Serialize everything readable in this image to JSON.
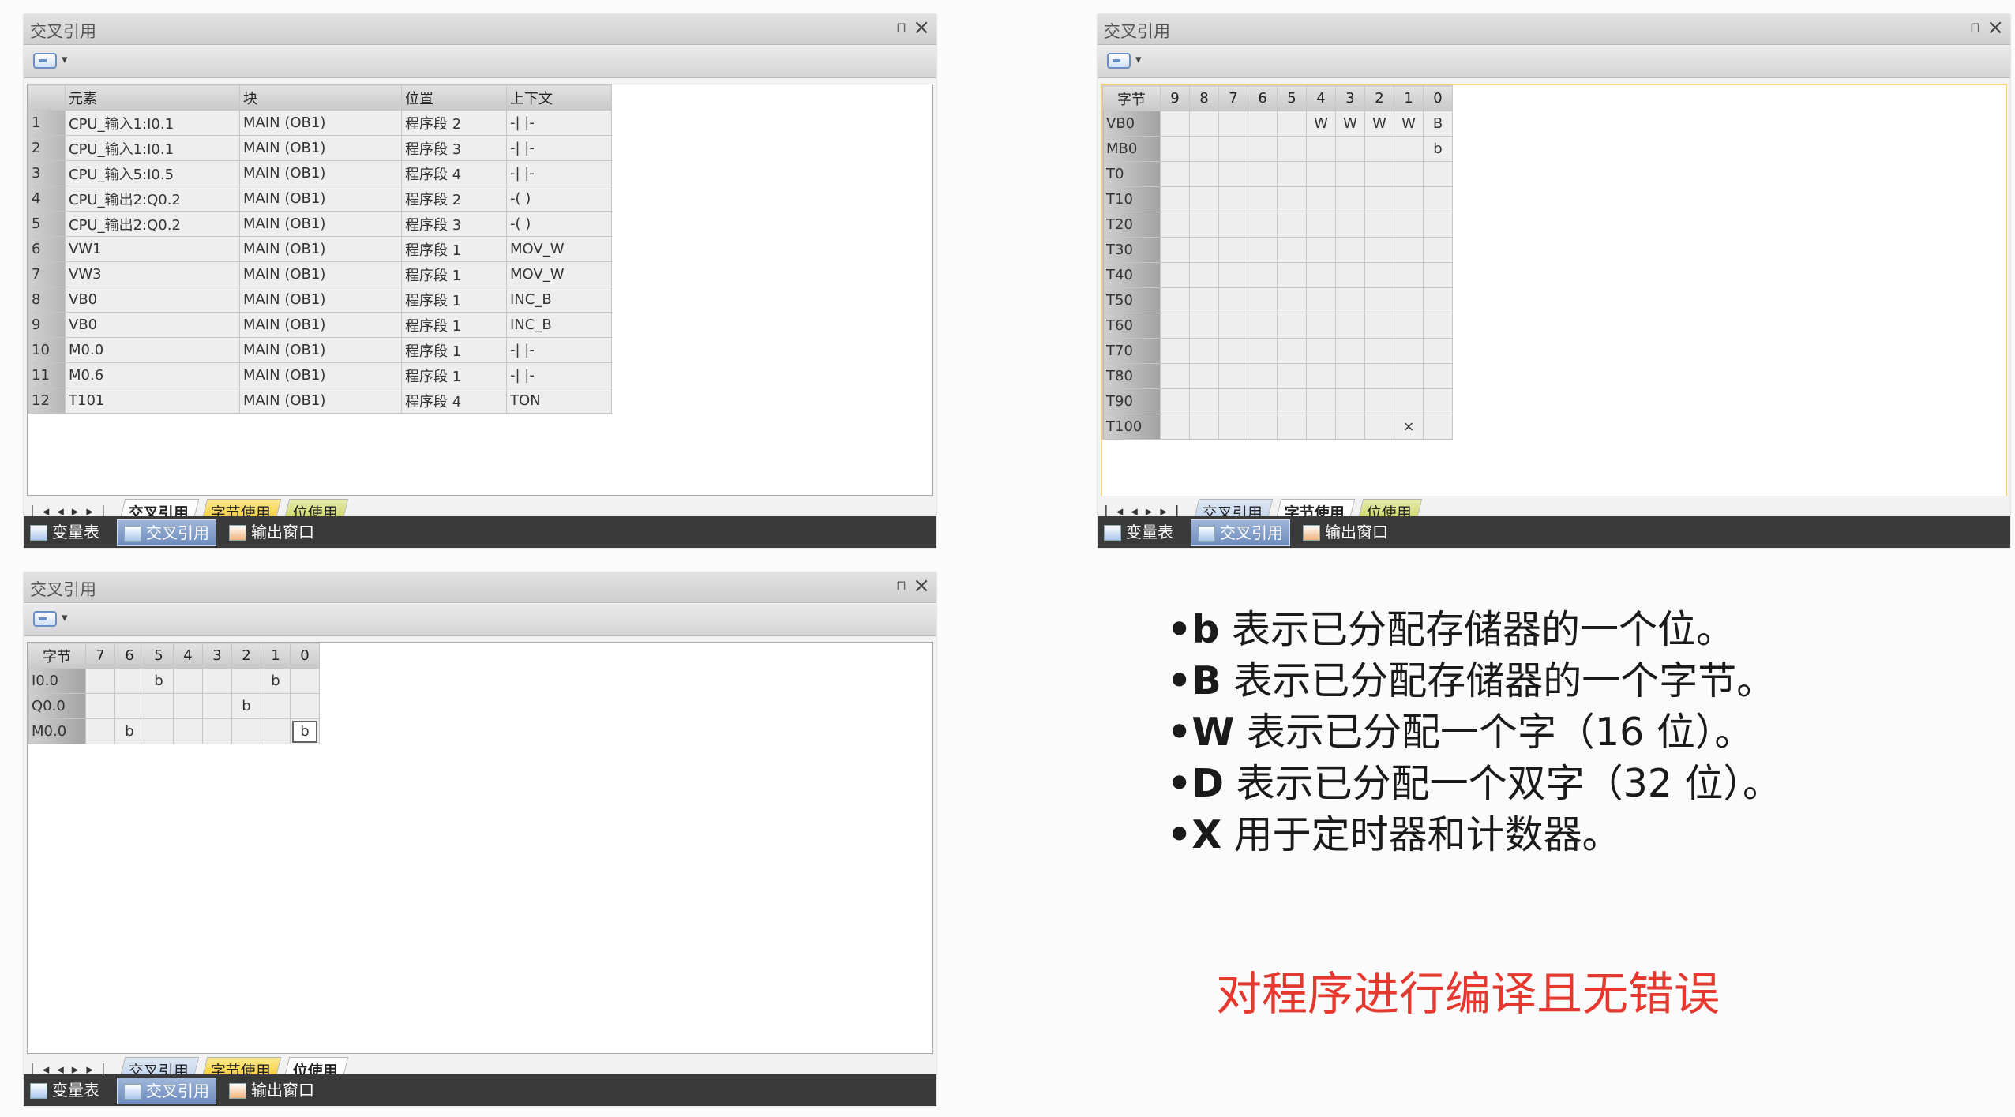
{
  "common": {
    "panel_title": "交叉引用",
    "tabs": [
      "交叉引用",
      "字节使用",
      "位使用"
    ],
    "status": [
      "变量表",
      "交叉引用",
      "输出窗口"
    ]
  },
  "cross_ref": {
    "headers": [
      "",
      "元素",
      "块",
      "位置",
      "上下文"
    ],
    "rows": [
      [
        "1",
        "CPU_输入1:I0.1",
        "MAIN (OB1)",
        "程序段 2",
        "-| |-"
      ],
      [
        "2",
        "CPU_输入1:I0.1",
        "MAIN (OB1)",
        "程序段 3",
        "-| |-"
      ],
      [
        "3",
        "CPU_输入5:I0.5",
        "MAIN (OB1)",
        "程序段 4",
        "-| |-"
      ],
      [
        "4",
        "CPU_输出2:Q0.2",
        "MAIN (OB1)",
        "程序段 2",
        "-( )"
      ],
      [
        "5",
        "CPU_输出2:Q0.2",
        "MAIN (OB1)",
        "程序段 3",
        "-( )"
      ],
      [
        "6",
        "VW1",
        "MAIN (OB1)",
        "程序段 1",
        "MOV_W"
      ],
      [
        "7",
        "VW3",
        "MAIN (OB1)",
        "程序段 1",
        "MOV_W"
      ],
      [
        "8",
        "VB0",
        "MAIN (OB1)",
        "程序段 1",
        "INC_B"
      ],
      [
        "9",
        "VB0",
        "MAIN (OB1)",
        "程序段 1",
        "INC_B"
      ],
      [
        "10",
        "M0.0",
        "MAIN (OB1)",
        "程序段 1",
        "-| |-"
      ],
      [
        "11",
        "M0.6",
        "MAIN (OB1)",
        "程序段 1",
        "-| |-"
      ],
      [
        "12",
        "T101",
        "MAIN (OB1)",
        "程序段 4",
        "TON"
      ]
    ]
  },
  "byte_usage": {
    "headers": [
      "字节",
      "9",
      "8",
      "7",
      "6",
      "5",
      "4",
      "3",
      "2",
      "1",
      "0"
    ],
    "rows": [
      [
        "VB0",
        "",
        "",
        "",
        "",
        "",
        "W",
        "W",
        "W",
        "W",
        "B"
      ],
      [
        "MB0",
        "",
        "",
        "",
        "",
        "",
        "",
        "",
        "",
        "",
        "b"
      ],
      [
        "T0",
        "",
        "",
        "",
        "",
        "",
        "",
        "",
        "",
        "",
        ""
      ],
      [
        "T10",
        "",
        "",
        "",
        "",
        "",
        "",
        "",
        "",
        "",
        ""
      ],
      [
        "T20",
        "",
        "",
        "",
        "",
        "",
        "",
        "",
        "",
        "",
        ""
      ],
      [
        "T30",
        "",
        "",
        "",
        "",
        "",
        "",
        "",
        "",
        "",
        ""
      ],
      [
        "T40",
        "",
        "",
        "",
        "",
        "",
        "",
        "",
        "",
        "",
        ""
      ],
      [
        "T50",
        "",
        "",
        "",
        "",
        "",
        "",
        "",
        "",
        "",
        ""
      ],
      [
        "T60",
        "",
        "",
        "",
        "",
        "",
        "",
        "",
        "",
        "",
        ""
      ],
      [
        "T70",
        "",
        "",
        "",
        "",
        "",
        "",
        "",
        "",
        "",
        ""
      ],
      [
        "T80",
        "",
        "",
        "",
        "",
        "",
        "",
        "",
        "",
        "",
        ""
      ],
      [
        "T90",
        "",
        "",
        "",
        "",
        "",
        "",
        "",
        "",
        "",
        ""
      ],
      [
        "T100",
        "",
        "",
        "",
        "",
        "",
        "",
        "",
        "",
        "×",
        ""
      ]
    ]
  },
  "bit_usage": {
    "headers": [
      "字节",
      "7",
      "6",
      "5",
      "4",
      "3",
      "2",
      "1",
      "0"
    ],
    "rows": [
      [
        "I0.0",
        "",
        "",
        "b",
        "",
        "",
        "",
        "b",
        ""
      ],
      [
        "Q0.0",
        "",
        "",
        "",
        "",
        "",
        "b",
        "",
        ""
      ],
      [
        "M0.0",
        "",
        "b",
        "",
        "",
        "",
        "",
        "",
        "b"
      ]
    ]
  },
  "legend": [
    {
      "key": "•b",
      "text": " 表示已分配存储器的一个位。"
    },
    {
      "key": "•B",
      "text": " 表示已分配存储器的一个字节。"
    },
    {
      "key": "•W",
      "text": " 表示已分配一个字（16 位）。"
    },
    {
      "key": "•D",
      "text": " 表示已分配一个双字（32 位）。"
    },
    {
      "key": "•X",
      "text": " 用于定时器和计数器。"
    }
  ],
  "compile_note": "对程序进行编译且无错误"
}
